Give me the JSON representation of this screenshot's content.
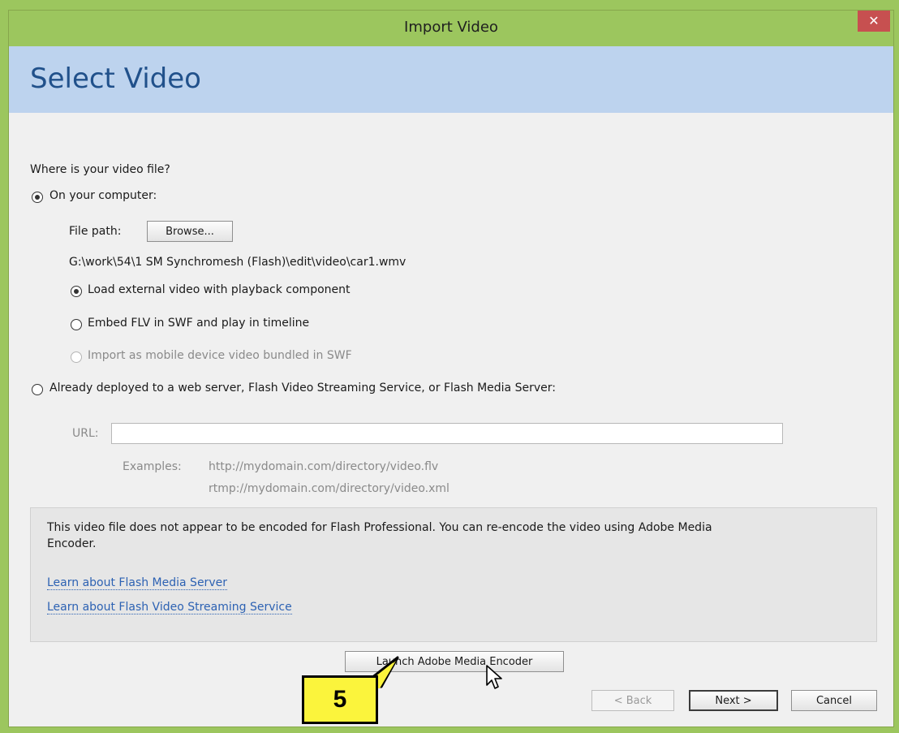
{
  "window": {
    "title": "Import Video",
    "close_glyph": "✕"
  },
  "header": {
    "title": "Select Video"
  },
  "question": "Where is your video file?",
  "local_option": {
    "label": "On your computer:",
    "selected": true,
    "file_path_label": "File path:",
    "browse_label": "Browse...",
    "file_path_value": "G:\\work\\54\\1 SM Synchromesh (Flash)\\edit\\video\\car1.wmv",
    "sub_options": [
      {
        "label": "Load external video with playback component",
        "selected": true,
        "enabled": true
      },
      {
        "label": "Embed FLV in SWF and play in timeline",
        "selected": false,
        "enabled": true
      },
      {
        "label": "Import as mobile device video bundled in SWF",
        "selected": false,
        "enabled": false
      }
    ]
  },
  "server_option": {
    "label": "Already deployed to a web server, Flash Video Streaming Service, or Flash Media Server:",
    "selected": false,
    "url_label": "URL:",
    "url_value": "",
    "examples_label": "Examples:",
    "example_1": "http://mydomain.com/directory/video.flv",
    "example_2": "rtmp://mydomain.com/directory/video.xml"
  },
  "info": {
    "message_line_1": "This video file does not appear to be encoded for Flash Professional. You can re-encode the video using Adobe Media",
    "message_line_2": "Encoder.",
    "link_1": "Learn about Flash Media Server",
    "link_2": "Learn about Flash Video Streaming Service"
  },
  "buttons": {
    "launch_encoder": "Launch Adobe Media Encoder",
    "back": "< Back",
    "next": "Next >",
    "cancel": "Cancel"
  },
  "callout": {
    "number": "5"
  },
  "colors": {
    "title_bar": "#9cc65e",
    "header_band": "#bdd3ee",
    "header_text": "#21518b",
    "link": "#2d62b3",
    "callout_fill": "#fbf43c",
    "close_button": "#c75050"
  }
}
